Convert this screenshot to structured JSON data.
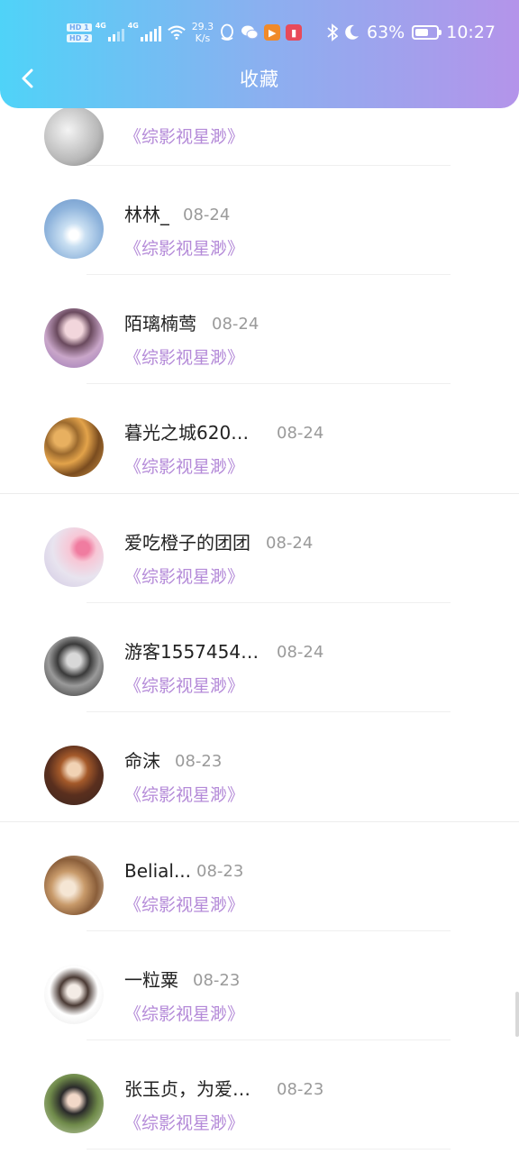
{
  "status_bar": {
    "hd1": "HD 1",
    "hd2": "HD 2",
    "net1": "4G",
    "net2": "4G",
    "speed_value": "29.3",
    "speed_unit": "K/s",
    "battery": "63%",
    "battery_level": 0.63,
    "time": "10:27"
  },
  "header": {
    "title": "收藏"
  },
  "items": [
    {
      "name": "",
      "date": "",
      "book": "《综影视星渺》"
    },
    {
      "name": "林林_",
      "date": "08-24",
      "book": "《综影视星渺》"
    },
    {
      "name": "陌璃楠莺",
      "date": "08-24",
      "book": "《综影视星渺》"
    },
    {
      "name": "暮光之城620…",
      "date": "08-24",
      "book": "《综影视星渺》"
    },
    {
      "name": "爱吃橙子的团团",
      "date": "08-24",
      "book": "《综影视星渺》"
    },
    {
      "name": "游客1557454…",
      "date": "08-24",
      "book": "《综影视星渺》"
    },
    {
      "name": "命沫",
      "date": "08-23",
      "book": "《综影视星渺》"
    },
    {
      "name": "Belial...",
      "date": "08-23",
      "book": "《综影视星渺》"
    },
    {
      "name": "一粒粟",
      "date": "08-23",
      "book": "《综影视星渺》"
    },
    {
      "name": "张玉贞，为爱…",
      "date": "08-23",
      "book": "《综影视星渺》"
    }
  ],
  "colors": {
    "accent": "#b48ad8",
    "header_start": "#4fd3f8",
    "header_end": "#b494ea"
  }
}
